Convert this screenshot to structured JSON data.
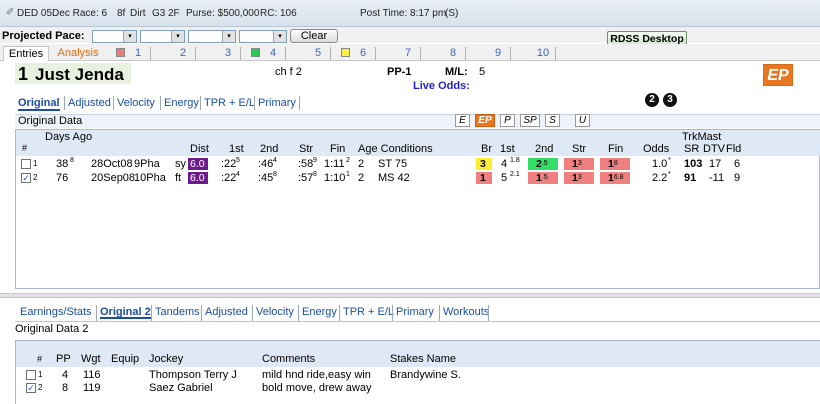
{
  "race": {
    "track": "DED",
    "date": "05Dec",
    "race_label": "Race: 6",
    "distance": "8f",
    "surface": "Dirt",
    "grade": "G3",
    "sex": "2F",
    "purse": "Purse: $500,000",
    "rc": "RC: 106",
    "post_time": "Post Time: 8:17 pm",
    "post_tz": "(S)"
  },
  "toolbar": {
    "projected_pace_label": "Projected Pace:",
    "clear_label": "Clear",
    "rdss_label": "RDSS Desktop",
    "dropdown_arrow": "▾"
  },
  "top_tabs": [
    "Entries",
    "Analysis"
  ],
  "horse_tabs": [
    {
      "num": "1",
      "color": "#e87b7b"
    },
    {
      "num": "2",
      "color": ""
    },
    {
      "num": "3",
      "color": ""
    },
    {
      "num": "4",
      "color": "#22cc55"
    },
    {
      "num": "5",
      "color": ""
    },
    {
      "num": "6",
      "color": "#ffee44"
    },
    {
      "num": "7",
      "color": ""
    },
    {
      "num": "8",
      "color": ""
    },
    {
      "num": "9",
      "color": ""
    },
    {
      "num": "10",
      "color": ""
    }
  ],
  "horse": {
    "program": "1",
    "name": "Just Jenda",
    "sex_age": "ch f 2",
    "pp_label": "PP-1",
    "ml_label": "M/L:",
    "ml_value": "5",
    "live_odds_label": "Live Odds:",
    "logo_text": "EP",
    "circle_buttons": [
      "2",
      "3"
    ]
  },
  "view_tabs": [
    "Original",
    "Adjusted",
    "Velocity",
    "Energy",
    "TPR + E/L",
    "Primary"
  ],
  "original_data": {
    "title": "Original Data",
    "mode_buttons": [
      "E",
      "EP",
      "P",
      "SP",
      "S",
      "U"
    ],
    "headers": {
      "days_ago": "Days Ago",
      "num": "#",
      "dist": "Dist",
      "first": "1st",
      "second": "2nd",
      "str": "Str",
      "fin": "Fin",
      "age_cond": "Age Conditions",
      "br": "Br",
      "c_first": "1st",
      "c_second": "2nd",
      "c_str": "Str",
      "c_fin": "Fin",
      "odds": "Odds",
      "trkmast": "TrkMast",
      "sr": "SR",
      "dtv": "DTV",
      "fld": "Fld"
    },
    "rows": [
      {
        "checked": false,
        "idx": "1",
        "days": "38",
        "days_sup": "8",
        "date": "28Oct08",
        "race": "9Pha",
        "cond": "sy",
        "dist": "6.0",
        "first": ":22",
        "first_sup": "5",
        "second": ":46",
        "second_sup": "4",
        "str": ":58",
        "str_sup": "9",
        "fin": "1:11",
        "fin_sup": "2",
        "age": "2",
        "conditions": "ST 75",
        "br": "3",
        "c1": "4",
        "c1_sup": "1.8",
        "c2": "2",
        "c2_sup": ".5",
        "c3": "1",
        "c3_sup": "3",
        "c4": "1",
        "c4_sup": "8",
        "odds": "1.0",
        "odds_sup": "*",
        "sr": "103",
        "dtv": "17",
        "fld": "6"
      },
      {
        "checked": true,
        "idx": "2",
        "days": "76",
        "days_sup": "",
        "date": "20Sep08",
        "race": "10Pha",
        "cond": "ft",
        "dist": "6.0",
        "first": ":22",
        "first_sup": "4",
        "second": ":45",
        "second_sup": "8",
        "str": ":57",
        "str_sup": "8",
        "fin": "1:10",
        "fin_sup": "1",
        "age": "2",
        "conditions": "MS 42",
        "br": "1",
        "c1": "5",
        "c1_sup": "2.1",
        "c2": "1",
        "c2_sup": ".5",
        "c3": "1",
        "c3_sup": "3",
        "c4": "1",
        "c4_sup": "6.8",
        "odds": "2.2",
        "odds_sup": "*",
        "sr": "91",
        "dtv": "-11",
        "fld": "9"
      }
    ]
  },
  "bottom_tabs": [
    "Earnings/Stats",
    "Original 2",
    "Tandems",
    "Adjusted",
    "Velocity",
    "Energy",
    "TPR + E/L",
    "Primary",
    "Workouts"
  ],
  "original_data2": {
    "title": "Original Data 2",
    "headers": {
      "num": "#",
      "pp": "PP",
      "wgt": "Wgt",
      "equip": "Equip",
      "jockey": "Jockey",
      "comments": "Comments",
      "stakes": "Stakes Name"
    },
    "rows": [
      {
        "checked": false,
        "idx": "1",
        "pp": "4",
        "wgt": "116",
        "equip": "",
        "jockey": "Thompson Terry J",
        "comments": "mild hnd ride,easy win",
        "stakes": "Brandywine S."
      },
      {
        "checked": true,
        "idx": "2",
        "pp": "8",
        "wgt": "119",
        "equip": "",
        "jockey": "Saez Gabriel",
        "comments": "bold move, drew away",
        "stakes": ""
      }
    ]
  },
  "colors": {
    "yellow": "#ffee33",
    "green": "#33dd66",
    "red": "#f08080",
    "purple": "#6d1a8c",
    "accent_blue": "#1b4ea3",
    "orange": "#e87722"
  }
}
